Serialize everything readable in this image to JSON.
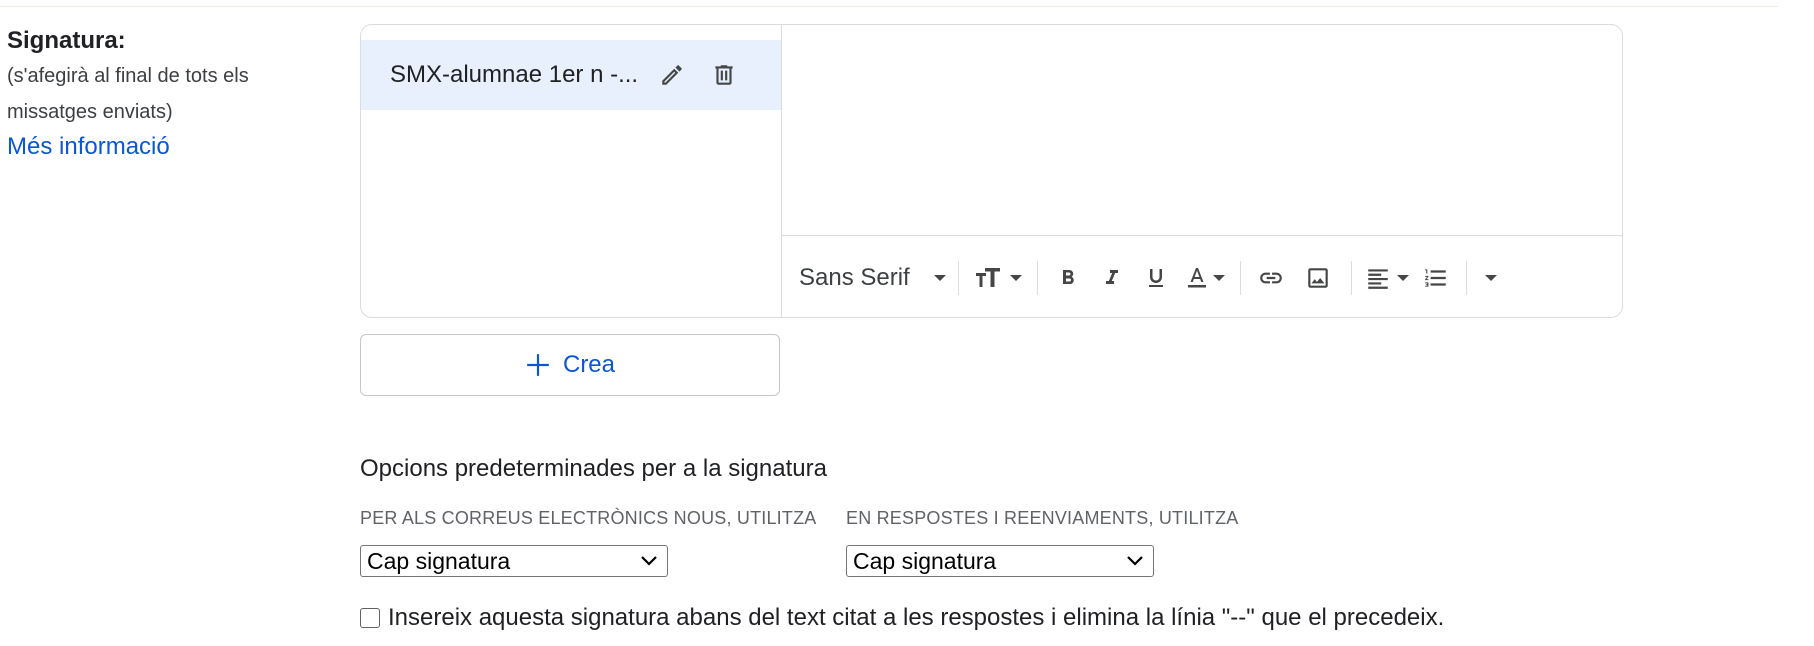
{
  "signature_section": {
    "title": "Signatura:",
    "description": "(s'afegirà al final de tots els missatges enviats)",
    "more_info_link": "Més informació"
  },
  "signatures": {
    "items": [
      {
        "name": "SMX-alumnae 1er n -...",
        "selected": true
      }
    ]
  },
  "toolbar": {
    "font_family": "Sans Serif",
    "buttons": [
      "font-size",
      "bold",
      "italic",
      "underline",
      "text-color",
      "link",
      "image",
      "align",
      "numbered-list",
      "more"
    ]
  },
  "create_button": {
    "label": "Crea"
  },
  "defaults": {
    "title": "Opcions predeterminades per a la signatura",
    "new_emails_label": "PER ALS CORREUS ELECTRÒNICS NOUS, UTILITZA",
    "new_emails_value": "Cap signatura",
    "replies_label": "EN RESPOSTES I REENVIAMENTS, UTILITZA",
    "replies_value": "Cap signatura",
    "insert_before_quoted_text": "Insereix aquesta signatura abans del text citat a les respostes i elimina la línia \"--\" que el precedeix.",
    "insert_before_checked": false
  },
  "colors": {
    "link": "#0b57d0",
    "selected_item_bg": "#e8f0fe",
    "border": "#dadce0",
    "text": "#202124",
    "muted_text": "#5f6368"
  }
}
